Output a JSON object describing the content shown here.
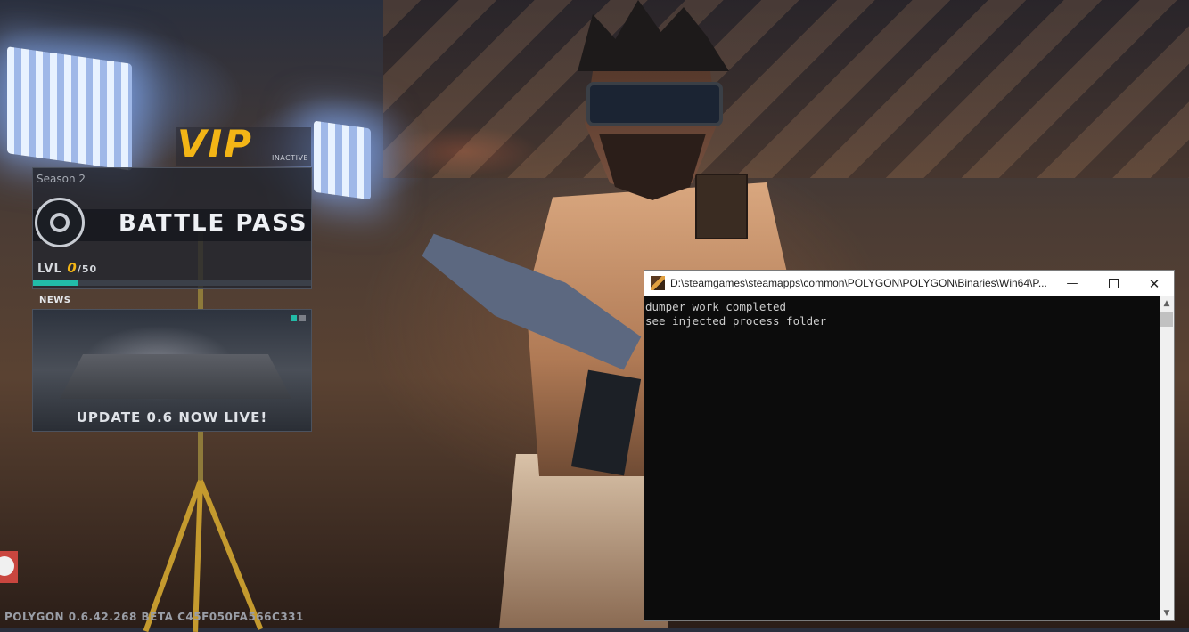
{
  "vip": {
    "label": "VIP",
    "status": "INACTIVE"
  },
  "battle_pass": {
    "season": "Season 2",
    "title": "BATTLE PASS",
    "level_prefix": "LVL",
    "level_current": "0",
    "level_max": "/50",
    "progress_fraction": 0.16,
    "progress_color": "#22bba8"
  },
  "news": {
    "label": "NEWS",
    "caption": "UPDATE 0.6 NOW LIVE!",
    "slide_count": 2,
    "active_slide": 1
  },
  "footer": {
    "version": "POLYGON 0.6.42.268 BETA C45F050FA566C331"
  },
  "console": {
    "title": "D:\\steamgames\\steamapps\\common\\POLYGON\\POLYGON\\Binaries\\Win64\\P...",
    "minimize_icon": "minimize-icon",
    "maximize_icon": "maximize-icon",
    "close_icon": "close-icon",
    "lines": [
      "dumper work completed",
      "see injected process folder"
    ]
  },
  "colors": {
    "accent_gold": "#f3b516",
    "accent_teal": "#22bba8",
    "side_button": "#c9463f"
  }
}
